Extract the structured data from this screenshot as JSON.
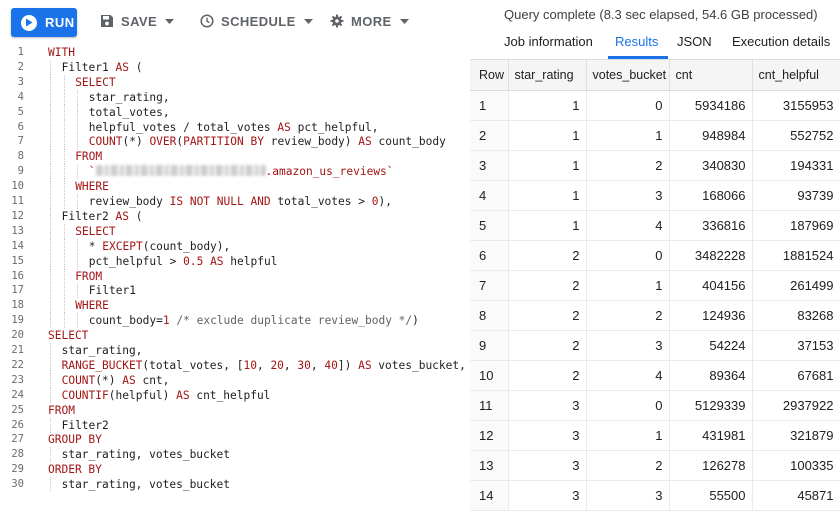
{
  "toolbar": {
    "run_label": "RUN",
    "save_label": "SAVE",
    "schedule_label": "SCHEDULE",
    "more_label": "MORE"
  },
  "editor": {
    "lines": [
      {
        "n": "1",
        "indent": 0,
        "parts": [
          [
            "kw",
            "WITH"
          ]
        ]
      },
      {
        "n": "2",
        "indent": 1,
        "parts": [
          [
            "pl",
            "Filter1 "
          ],
          [
            "kw",
            "AS"
          ],
          [
            "pl",
            " ("
          ]
        ]
      },
      {
        "n": "3",
        "indent": 2,
        "parts": [
          [
            "kw",
            "SELECT"
          ]
        ]
      },
      {
        "n": "4",
        "indent": 3,
        "parts": [
          [
            "pl",
            "star_rating,"
          ]
        ]
      },
      {
        "n": "5",
        "indent": 3,
        "parts": [
          [
            "pl",
            "total_votes,"
          ]
        ]
      },
      {
        "n": "6",
        "indent": 3,
        "parts": [
          [
            "pl",
            "helpful_votes / total_votes "
          ],
          [
            "kw",
            "AS"
          ],
          [
            "pl",
            " pct_helpful,"
          ]
        ]
      },
      {
        "n": "7",
        "indent": 3,
        "parts": [
          [
            "kw",
            "COUNT"
          ],
          [
            "pl",
            "(*) "
          ],
          [
            "kw",
            "OVER"
          ],
          [
            "pl",
            "("
          ],
          [
            "kw",
            "PARTITION BY"
          ],
          [
            "pl",
            " review_body) "
          ],
          [
            "kw",
            "AS"
          ],
          [
            "pl",
            " count_body"
          ]
        ]
      },
      {
        "n": "8",
        "indent": 2,
        "parts": [
          [
            "kw",
            "FROM"
          ]
        ]
      },
      {
        "n": "9",
        "indent": 3,
        "parts": [
          [
            "kw",
            "`"
          ],
          [
            "blur",
            ""
          ],
          [
            "kw",
            ".amazon_us_reviews`"
          ]
        ]
      },
      {
        "n": "10",
        "indent": 2,
        "parts": [
          [
            "kw",
            "WHERE"
          ]
        ]
      },
      {
        "n": "11",
        "indent": 3,
        "parts": [
          [
            "pl",
            "review_body "
          ],
          [
            "kw",
            "IS NOT NULL AND"
          ],
          [
            "pl",
            " total_votes > "
          ],
          [
            "kw",
            "0"
          ],
          [
            "pl",
            "),"
          ]
        ]
      },
      {
        "n": "12",
        "indent": 1,
        "parts": [
          [
            "pl",
            "Filter2 "
          ],
          [
            "kw",
            "AS"
          ],
          [
            "pl",
            " ("
          ]
        ]
      },
      {
        "n": "13",
        "indent": 2,
        "parts": [
          [
            "kw",
            "SELECT"
          ]
        ]
      },
      {
        "n": "14",
        "indent": 3,
        "parts": [
          [
            "pl",
            "* "
          ],
          [
            "kw",
            "EXCEPT"
          ],
          [
            "pl",
            "(count_body),"
          ]
        ]
      },
      {
        "n": "15",
        "indent": 3,
        "parts": [
          [
            "pl",
            "pct_helpful > "
          ],
          [
            "kw",
            "0.5"
          ],
          [
            "pl",
            " "
          ],
          [
            "kw",
            "AS"
          ],
          [
            "pl",
            " helpful"
          ]
        ]
      },
      {
        "n": "16",
        "indent": 2,
        "parts": [
          [
            "kw",
            "FROM"
          ]
        ]
      },
      {
        "n": "17",
        "indent": 3,
        "parts": [
          [
            "pl",
            "Filter1"
          ]
        ]
      },
      {
        "n": "18",
        "indent": 2,
        "parts": [
          [
            "kw",
            "WHERE"
          ]
        ]
      },
      {
        "n": "19",
        "indent": 3,
        "parts": [
          [
            "pl",
            "count_body="
          ],
          [
            "kw",
            "1"
          ],
          [
            "pl",
            " "
          ],
          [
            "cm",
            "/* exclude duplicate review_body */"
          ],
          [
            "pl",
            ")"
          ]
        ]
      },
      {
        "n": "20",
        "indent": 0,
        "parts": [
          [
            "kw",
            "SELECT"
          ]
        ]
      },
      {
        "n": "21",
        "indent": 1,
        "parts": [
          [
            "pl",
            "star_rating,"
          ]
        ]
      },
      {
        "n": "22",
        "indent": 1,
        "parts": [
          [
            "kw",
            "RANGE_BUCKET"
          ],
          [
            "pl",
            "(total_votes, ["
          ],
          [
            "kw",
            "10"
          ],
          [
            "pl",
            ", "
          ],
          [
            "kw",
            "20"
          ],
          [
            "pl",
            ", "
          ],
          [
            "kw",
            "30"
          ],
          [
            "pl",
            ", "
          ],
          [
            "kw",
            "40"
          ],
          [
            "pl",
            "]) "
          ],
          [
            "kw",
            "AS"
          ],
          [
            "pl",
            " votes_bucket,"
          ]
        ]
      },
      {
        "n": "23",
        "indent": 1,
        "parts": [
          [
            "kw",
            "COUNT"
          ],
          [
            "pl",
            "(*) "
          ],
          [
            "kw",
            "AS"
          ],
          [
            "pl",
            " cnt,"
          ]
        ]
      },
      {
        "n": "24",
        "indent": 1,
        "parts": [
          [
            "kw",
            "COUNTIF"
          ],
          [
            "pl",
            "(helpful) "
          ],
          [
            "kw",
            "AS"
          ],
          [
            "pl",
            " cnt_helpful"
          ]
        ]
      },
      {
        "n": "25",
        "indent": 0,
        "parts": [
          [
            "kw",
            "FROM"
          ]
        ]
      },
      {
        "n": "26",
        "indent": 1,
        "parts": [
          [
            "pl",
            "Filter2"
          ]
        ]
      },
      {
        "n": "27",
        "indent": 0,
        "parts": [
          [
            "kw",
            "GROUP BY"
          ]
        ]
      },
      {
        "n": "28",
        "indent": 1,
        "parts": [
          [
            "pl",
            "star_rating, votes_bucket"
          ]
        ]
      },
      {
        "n": "29",
        "indent": 0,
        "parts": [
          [
            "kw",
            "ORDER BY"
          ]
        ]
      },
      {
        "n": "30",
        "indent": 1,
        "parts": [
          [
            "pl",
            "star_rating, votes_bucket"
          ]
        ]
      }
    ]
  },
  "results": {
    "status": "Query complete (8.3 sec elapsed, 54.6 GB processed)",
    "tabs": [
      {
        "label": "Job information",
        "active": false
      },
      {
        "label": "Results",
        "active": true
      },
      {
        "label": "JSON",
        "active": false
      },
      {
        "label": "Execution details",
        "active": false
      }
    ],
    "columns": [
      "Row",
      "star_rating",
      "votes_bucket",
      "cnt",
      "cnt_helpful"
    ],
    "rows": [
      [
        "1",
        "1",
        "0",
        "5934186",
        "3155953"
      ],
      [
        "2",
        "1",
        "1",
        "948984",
        "552752"
      ],
      [
        "3",
        "1",
        "2",
        "340830",
        "194331"
      ],
      [
        "4",
        "1",
        "3",
        "168066",
        "93739"
      ],
      [
        "5",
        "1",
        "4",
        "336816",
        "187969"
      ],
      [
        "6",
        "2",
        "0",
        "3482228",
        "1881524"
      ],
      [
        "7",
        "2",
        "1",
        "404156",
        "261499"
      ],
      [
        "8",
        "2",
        "2",
        "124936",
        "83268"
      ],
      [
        "9",
        "2",
        "3",
        "54224",
        "37153"
      ],
      [
        "10",
        "2",
        "4",
        "89364",
        "67681"
      ],
      [
        "11",
        "3",
        "0",
        "5129339",
        "2937922"
      ],
      [
        "12",
        "3",
        "1",
        "431981",
        "321879"
      ],
      [
        "13",
        "3",
        "2",
        "126278",
        "100335"
      ],
      [
        "14",
        "3",
        "3",
        "55500",
        "45871"
      ]
    ]
  },
  "icons": {
    "run": "play-icon",
    "save": "floppy-disk-icon",
    "schedule": "clock-icon",
    "more": "gear-icon"
  },
  "colors": {
    "accent": "#1a73e8",
    "keyword": "#a31515"
  }
}
